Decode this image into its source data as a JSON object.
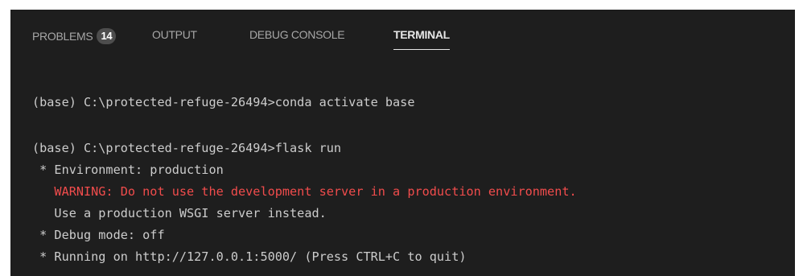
{
  "tabs": {
    "problems": {
      "label": "PROBLEMS",
      "count": "14"
    },
    "output": {
      "label": "OUTPUT"
    },
    "debug_console": {
      "label": "DEBUG CONSOLE"
    },
    "terminal": {
      "label": "TERMINAL"
    }
  },
  "active_tab": "TERMINAL",
  "terminal": {
    "lines": [
      "(base) C:\\protected-refuge-26494>conda activate base",
      "(base) C:\\protected-refuge-26494>flask run",
      " * Environment: production",
      "   WARNING: Do not use the development server in a production environment.",
      "   Use a production WSGI server instead.",
      " * Debug mode: off",
      " * Running on http://127.0.0.1:5000/ (Press CTRL+C to quit)"
    ]
  },
  "colors": {
    "background": "#1e1e1e",
    "text": "#cccccc",
    "warning": "#f14c4c",
    "tab_inactive": "#a7a7a7",
    "tab_active": "#e7e7e7",
    "badge": "#4d4d4d"
  }
}
